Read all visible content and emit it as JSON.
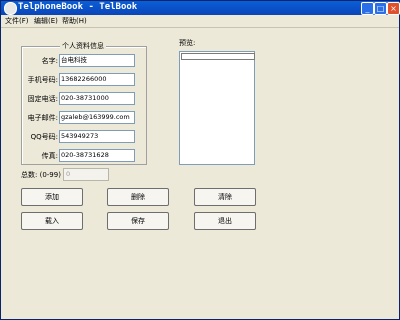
{
  "window": {
    "title": "TelphoneBook - TelBook",
    "controls": {
      "minimize": "_",
      "maximize": "□",
      "close": "×"
    }
  },
  "menu": [
    "文件(F)",
    "编辑(E)",
    "帮助(H)"
  ],
  "info": {
    "group_title": "个人资料信息",
    "fields": [
      {
        "label": "名字:",
        "value": "台电科技"
      },
      {
        "label": "手机号码:",
        "value": "13682266000"
      },
      {
        "label": "固定电话:",
        "value": "020-38731000"
      },
      {
        "label": "电子邮件:",
        "value": "gzaleb@163999.com"
      },
      {
        "label": "QQ号码:",
        "value": "543949273"
      },
      {
        "label": "传真:",
        "value": "020-38731628"
      }
    ]
  },
  "preview": {
    "label": "预览:"
  },
  "total": {
    "label": "总数: (0-99)",
    "value": "0"
  },
  "buttons": {
    "add": "添加",
    "delete": "删除",
    "clear": "清除",
    "load": "载入",
    "save": "保存",
    "exit": "退出"
  }
}
